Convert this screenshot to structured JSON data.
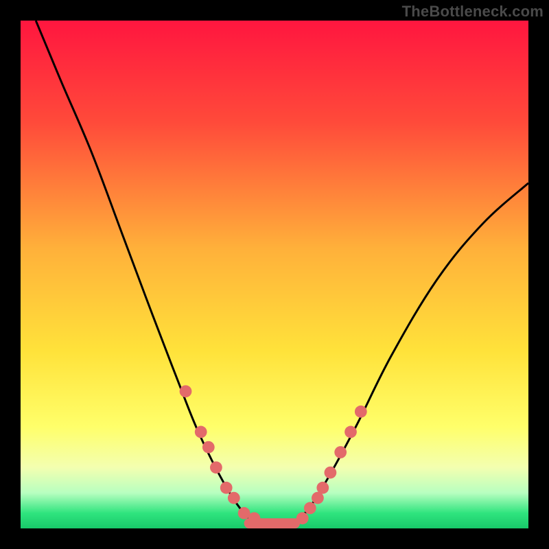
{
  "watermark": "TheBottleneck.com",
  "chart_data": {
    "type": "line",
    "title": "",
    "xlabel": "",
    "ylabel": "",
    "xlim": [
      0,
      100
    ],
    "ylim": [
      0,
      100
    ],
    "gradient_stops": [
      {
        "offset": 0,
        "color": "#ff163f"
      },
      {
        "offset": 20,
        "color": "#ff4a3a"
      },
      {
        "offset": 45,
        "color": "#ffb13a"
      },
      {
        "offset": 65,
        "color": "#ffe23a"
      },
      {
        "offset": 80,
        "color": "#ffff6a"
      },
      {
        "offset": 88,
        "color": "#f3ffb0"
      },
      {
        "offset": 93,
        "color": "#b8ffc0"
      },
      {
        "offset": 97,
        "color": "#2fe47e"
      },
      {
        "offset": 100,
        "color": "#18c96a"
      }
    ],
    "curve": [
      {
        "x": 3,
        "y": 100
      },
      {
        "x": 8,
        "y": 88
      },
      {
        "x": 14,
        "y": 74
      },
      {
        "x": 20,
        "y": 58
      },
      {
        "x": 26,
        "y": 42
      },
      {
        "x": 31,
        "y": 29
      },
      {
        "x": 35,
        "y": 19
      },
      {
        "x": 40,
        "y": 9
      },
      {
        "x": 44,
        "y": 3
      },
      {
        "x": 47,
        "y": 1
      },
      {
        "x": 50,
        "y": 1
      },
      {
        "x": 53,
        "y": 1
      },
      {
        "x": 56,
        "y": 3
      },
      {
        "x": 60,
        "y": 9
      },
      {
        "x": 66,
        "y": 20
      },
      {
        "x": 73,
        "y": 34
      },
      {
        "x": 82,
        "y": 49
      },
      {
        "x": 91,
        "y": 60
      },
      {
        "x": 100,
        "y": 68
      }
    ],
    "markers_left": [
      {
        "x": 32.5,
        "y": 27
      },
      {
        "x": 35.5,
        "y": 19
      },
      {
        "x": 37.0,
        "y": 16
      },
      {
        "x": 38.5,
        "y": 12
      },
      {
        "x": 40.5,
        "y": 8
      },
      {
        "x": 42.0,
        "y": 6
      },
      {
        "x": 44.0,
        "y": 3
      },
      {
        "x": 46.0,
        "y": 2
      }
    ],
    "markers_right": [
      {
        "x": 55.5,
        "y": 2
      },
      {
        "x": 57.0,
        "y": 4
      },
      {
        "x": 58.5,
        "y": 6
      },
      {
        "x": 59.5,
        "y": 8
      },
      {
        "x": 61.0,
        "y": 11
      },
      {
        "x": 63.0,
        "y": 15
      },
      {
        "x": 65.0,
        "y": 19
      },
      {
        "x": 67.0,
        "y": 23
      }
    ],
    "flat_bar": {
      "x1": 44,
      "x2": 55,
      "y": 1
    },
    "marker_color": "#e36a6a",
    "marker_radius": 1.2,
    "curve_stroke": "#000000",
    "curve_width": 0.45
  }
}
